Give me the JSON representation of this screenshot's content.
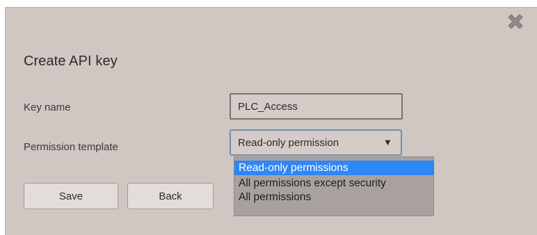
{
  "dialog": {
    "title": "Create API key",
    "close_icon": "close-x-icon"
  },
  "form": {
    "key_name": {
      "label": "Key name",
      "value": "PLC_Access"
    },
    "permission_template": {
      "label": "Permission template",
      "selected_display": "Read-only permission",
      "arrow": "▼",
      "options": [
        "Read-only permissions",
        "All permissions except security",
        "All permissions"
      ],
      "highlighted_index": 0
    }
  },
  "buttons": {
    "save_label": "Save",
    "back_label": "Back"
  },
  "colors": {
    "dialog_background": "#d0c6c2",
    "highlight": "#2f86f5",
    "dropdown_background": "#a8a19f",
    "focus_border": "#6c8fb3"
  }
}
